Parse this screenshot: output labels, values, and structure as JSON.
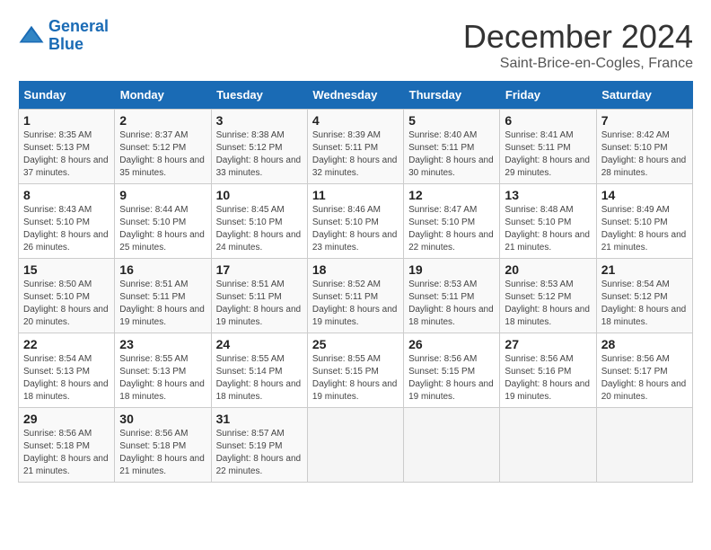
{
  "header": {
    "logo_line1": "General",
    "logo_line2": "Blue",
    "month_title": "December 2024",
    "location": "Saint-Brice-en-Cogles, France"
  },
  "days_of_week": [
    "Sunday",
    "Monday",
    "Tuesday",
    "Wednesday",
    "Thursday",
    "Friday",
    "Saturday"
  ],
  "weeks": [
    [
      {
        "day": "1",
        "sunrise": "8:35 AM",
        "sunset": "5:13 PM",
        "daylight": "8 hours and 37 minutes."
      },
      {
        "day": "2",
        "sunrise": "8:37 AM",
        "sunset": "5:12 PM",
        "daylight": "8 hours and 35 minutes."
      },
      {
        "day": "3",
        "sunrise": "8:38 AM",
        "sunset": "5:12 PM",
        "daylight": "8 hours and 33 minutes."
      },
      {
        "day": "4",
        "sunrise": "8:39 AM",
        "sunset": "5:11 PM",
        "daylight": "8 hours and 32 minutes."
      },
      {
        "day": "5",
        "sunrise": "8:40 AM",
        "sunset": "5:11 PM",
        "daylight": "8 hours and 30 minutes."
      },
      {
        "day": "6",
        "sunrise": "8:41 AM",
        "sunset": "5:11 PM",
        "daylight": "8 hours and 29 minutes."
      },
      {
        "day": "7",
        "sunrise": "8:42 AM",
        "sunset": "5:10 PM",
        "daylight": "8 hours and 28 minutes."
      }
    ],
    [
      {
        "day": "8",
        "sunrise": "8:43 AM",
        "sunset": "5:10 PM",
        "daylight": "8 hours and 26 minutes."
      },
      {
        "day": "9",
        "sunrise": "8:44 AM",
        "sunset": "5:10 PM",
        "daylight": "8 hours and 25 minutes."
      },
      {
        "day": "10",
        "sunrise": "8:45 AM",
        "sunset": "5:10 PM",
        "daylight": "8 hours and 24 minutes."
      },
      {
        "day": "11",
        "sunrise": "8:46 AM",
        "sunset": "5:10 PM",
        "daylight": "8 hours and 23 minutes."
      },
      {
        "day": "12",
        "sunrise": "8:47 AM",
        "sunset": "5:10 PM",
        "daylight": "8 hours and 22 minutes."
      },
      {
        "day": "13",
        "sunrise": "8:48 AM",
        "sunset": "5:10 PM",
        "daylight": "8 hours and 21 minutes."
      },
      {
        "day": "14",
        "sunrise": "8:49 AM",
        "sunset": "5:10 PM",
        "daylight": "8 hours and 21 minutes."
      }
    ],
    [
      {
        "day": "15",
        "sunrise": "8:50 AM",
        "sunset": "5:10 PM",
        "daylight": "8 hours and 20 minutes."
      },
      {
        "day": "16",
        "sunrise": "8:51 AM",
        "sunset": "5:11 PM",
        "daylight": "8 hours and 19 minutes."
      },
      {
        "day": "17",
        "sunrise": "8:51 AM",
        "sunset": "5:11 PM",
        "daylight": "8 hours and 19 minutes."
      },
      {
        "day": "18",
        "sunrise": "8:52 AM",
        "sunset": "5:11 PM",
        "daylight": "8 hours and 19 minutes."
      },
      {
        "day": "19",
        "sunrise": "8:53 AM",
        "sunset": "5:11 PM",
        "daylight": "8 hours and 18 minutes."
      },
      {
        "day": "20",
        "sunrise": "8:53 AM",
        "sunset": "5:12 PM",
        "daylight": "8 hours and 18 minutes."
      },
      {
        "day": "21",
        "sunrise": "8:54 AM",
        "sunset": "5:12 PM",
        "daylight": "8 hours and 18 minutes."
      }
    ],
    [
      {
        "day": "22",
        "sunrise": "8:54 AM",
        "sunset": "5:13 PM",
        "daylight": "8 hours and 18 minutes."
      },
      {
        "day": "23",
        "sunrise": "8:55 AM",
        "sunset": "5:13 PM",
        "daylight": "8 hours and 18 minutes."
      },
      {
        "day": "24",
        "sunrise": "8:55 AM",
        "sunset": "5:14 PM",
        "daylight": "8 hours and 18 minutes."
      },
      {
        "day": "25",
        "sunrise": "8:55 AM",
        "sunset": "5:15 PM",
        "daylight": "8 hours and 19 minutes."
      },
      {
        "day": "26",
        "sunrise": "8:56 AM",
        "sunset": "5:15 PM",
        "daylight": "8 hours and 19 minutes."
      },
      {
        "day": "27",
        "sunrise": "8:56 AM",
        "sunset": "5:16 PM",
        "daylight": "8 hours and 19 minutes."
      },
      {
        "day": "28",
        "sunrise": "8:56 AM",
        "sunset": "5:17 PM",
        "daylight": "8 hours and 20 minutes."
      }
    ],
    [
      {
        "day": "29",
        "sunrise": "8:56 AM",
        "sunset": "5:18 PM",
        "daylight": "8 hours and 21 minutes."
      },
      {
        "day": "30",
        "sunrise": "8:56 AM",
        "sunset": "5:18 PM",
        "daylight": "8 hours and 21 minutes."
      },
      {
        "day": "31",
        "sunrise": "8:57 AM",
        "sunset": "5:19 PM",
        "daylight": "8 hours and 22 minutes."
      },
      null,
      null,
      null,
      null
    ]
  ],
  "labels": {
    "sunrise_prefix": "Sunrise: ",
    "sunset_prefix": "Sunset: ",
    "daylight_label": "Daylight: "
  }
}
